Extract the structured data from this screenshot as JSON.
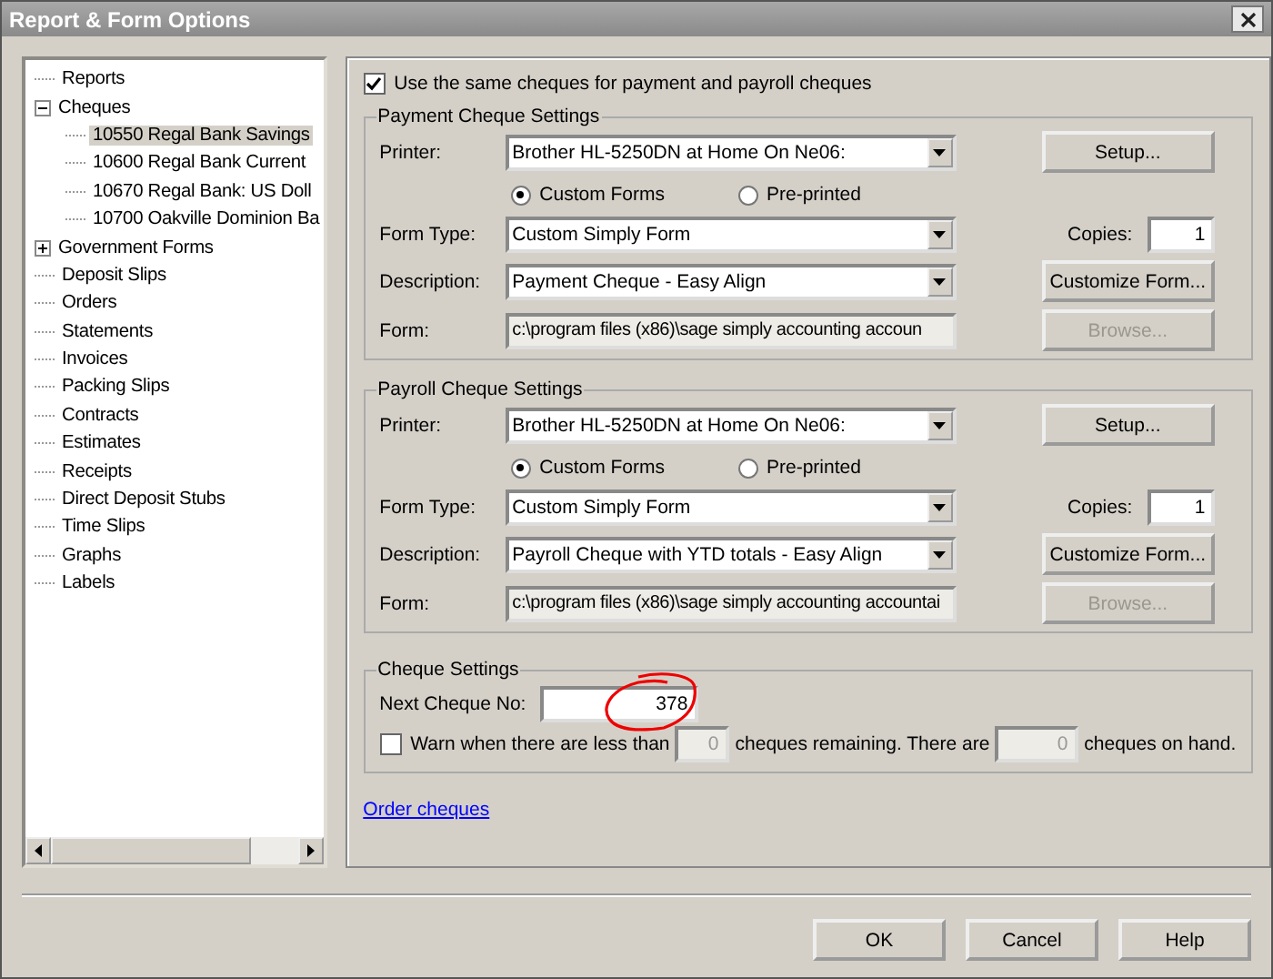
{
  "window": {
    "title": "Report & Form Options"
  },
  "tree": [
    {
      "label": "Reports",
      "selected": false
    },
    {
      "label": "Cheques",
      "selected": false,
      "expanded": true,
      "children": [
        {
          "label": "10550 Regal Bank Savings",
          "selected": true
        },
        {
          "label": "10600 Regal Bank Current",
          "selected": false
        },
        {
          "label": "10670 Regal Bank: US Doll",
          "selected": false
        },
        {
          "label": "10700 Oakville Dominion Ba",
          "selected": false
        }
      ]
    },
    {
      "label": "Government Forms",
      "selected": false,
      "expanded": false
    },
    {
      "label": "Deposit Slips",
      "selected": false
    },
    {
      "label": "Orders",
      "selected": false
    },
    {
      "label": "Statements",
      "selected": false
    },
    {
      "label": "Invoices",
      "selected": false
    },
    {
      "label": "Packing Slips",
      "selected": false
    },
    {
      "label": "Contracts",
      "selected": false
    },
    {
      "label": "Estimates",
      "selected": false
    },
    {
      "label": "Receipts",
      "selected": false
    },
    {
      "label": "Direct Deposit Stubs",
      "selected": false
    },
    {
      "label": "Time Slips",
      "selected": false
    },
    {
      "label": "Graphs",
      "selected": false
    },
    {
      "label": "Labels",
      "selected": false
    }
  ],
  "same_cheques": {
    "label": "Use the same cheques for payment and payroll cheques",
    "checked": true
  },
  "groups": [
    {
      "title": "Payment Cheque Settings",
      "printer_label": "Printer:",
      "printer": "Brother HL-5250DN at Home On Ne06:",
      "radios": [
        {
          "label": "Custom Forms",
          "selected": true
        },
        {
          "label": "Pre-printed",
          "selected": false
        }
      ],
      "form_type_label": "Form Type:",
      "form_type": "Custom Simply Form",
      "description_label": "Description:",
      "description": "Payment Cheque - Easy Align",
      "form_label": "Form:",
      "form": "c:\\program files (x86)\\sage simply accounting accoun",
      "setup": "Setup...",
      "copies_label": "Copies:",
      "copies": "1",
      "customize": "Customize Form...",
      "browse": {
        "label": "Browse...",
        "disabled": true
      }
    },
    {
      "title": "Payroll Cheque Settings",
      "printer_label": "Printer:",
      "printer": "Brother HL-5250DN at Home On Ne06:",
      "radios": [
        {
          "label": "Custom Forms",
          "selected": true
        },
        {
          "label": "Pre-printed",
          "selected": false
        }
      ],
      "form_type_label": "Form Type:",
      "form_type": "Custom Simply Form",
      "description_label": "Description:",
      "description": "Payroll Cheque with YTD totals - Easy Align",
      "form_label": "Form:",
      "form": "c:\\program files (x86)\\sage simply accounting accountai",
      "setup": "Setup...",
      "copies_label": "Copies:",
      "copies": "1",
      "customize": "Customize Form...",
      "browse": {
        "label": "Browse...",
        "disabled": true
      }
    }
  ],
  "cheque_settings": {
    "title": "Cheque Settings",
    "next_label": "Next Cheque No:",
    "next": "378",
    "warn": {
      "checked": false,
      "text_1": "Warn when there are less than",
      "remaining": "0",
      "text_2": "cheques remaining. There are",
      "on_hand": "0",
      "text_3": "cheques on hand."
    },
    "annotation": {
      "kind": "circle"
    }
  },
  "order_link": "Order cheques",
  "buttons": [
    "OK",
    "Cancel",
    "Help"
  ]
}
